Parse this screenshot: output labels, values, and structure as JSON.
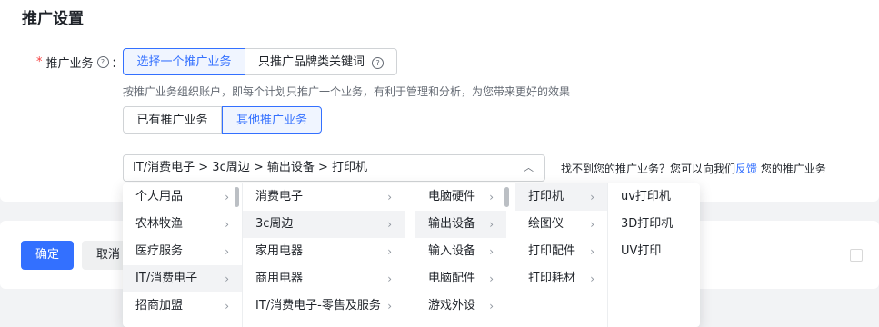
{
  "page": {
    "title": "推广设置"
  },
  "field": {
    "required_mark": "*",
    "label": "推广业务",
    "colon": "：",
    "help_glyph": "?"
  },
  "mode_tabs": [
    {
      "label": "选择一个推广业务",
      "active": true
    },
    {
      "label": "只推广品牌类关键词",
      "active": false,
      "help_glyph": "?"
    }
  ],
  "hint": "按推广业务组织账户，即每个计划只推广一个业务，有利于管理和分析，为您带来更好的效果",
  "source_tabs": [
    {
      "label": "已有推广业务",
      "active": false
    },
    {
      "label": "其他推广业务",
      "active": true
    }
  ],
  "cascader": {
    "value": "IT/消费电子 > 3c周边 > 输出设备 > 打印机",
    "toggle_icon": "chevron-up-icon",
    "columns": [
      {
        "items": [
          "个人用品",
          "农林牧渔",
          "医疗服务",
          "IT/消费电子",
          "招商加盟"
        ],
        "selected": 3
      },
      {
        "items": [
          "消费电子",
          "3c周边",
          "家用电器",
          "商用电器",
          "IT/消费电子-零售及服务"
        ],
        "selected": 1
      },
      {
        "items": [
          "电脑硬件",
          "输出设备",
          "输入设备",
          "电脑配件",
          "游戏外设"
        ],
        "selected": 1
      },
      {
        "items": [
          "打印机",
          "绘图仪",
          "打印配件",
          "打印耗材"
        ],
        "selected": 0
      },
      {
        "items": [
          "uv打印机",
          "3D打印机",
          "UV打印"
        ],
        "selected": -1
      }
    ]
  },
  "not_found": {
    "text_before": "找不到您的推广业务？您可以向我们",
    "link": "反馈",
    "text_after": " 您的推广业务"
  },
  "buttons": {
    "ok": "确定",
    "cancel": "取消"
  },
  "colors": {
    "accent": "#3370ff",
    "required": "#f53f3f"
  }
}
